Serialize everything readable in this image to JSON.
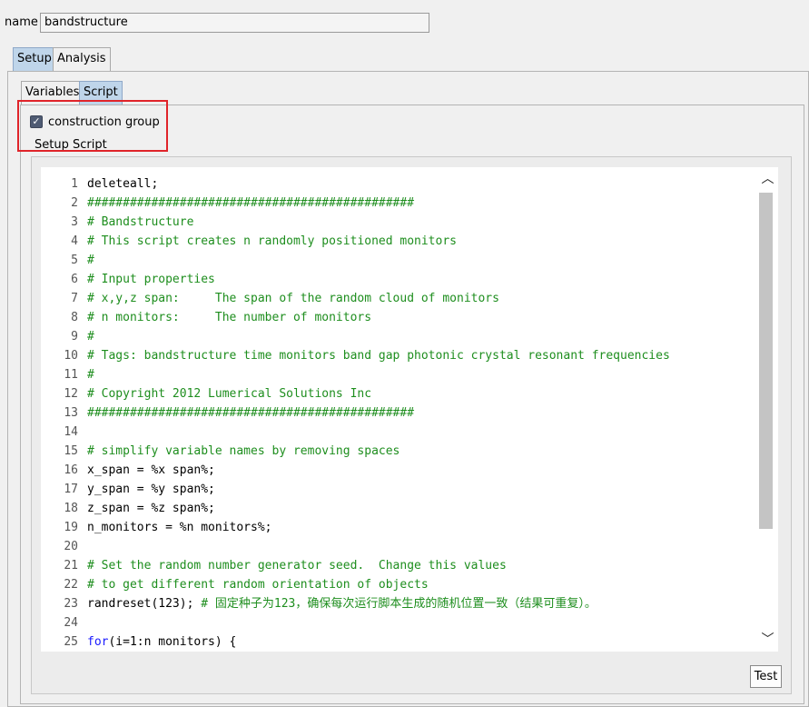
{
  "name_field": {
    "label": "name",
    "value": "bandstructure"
  },
  "tabs": [
    {
      "label": "Setup",
      "active": true
    },
    {
      "label": "Analysis",
      "active": false
    }
  ],
  "subtabs": [
    {
      "label": "Variables",
      "active": false
    },
    {
      "label": "Script",
      "active": true
    }
  ],
  "construction_group": {
    "label": "construction group",
    "checked": true
  },
  "setup_script_label": "Setup Script",
  "editor": {
    "lines": [
      {
        "n": "1",
        "segments": [
          {
            "t": "deleteall;",
            "c": "plain"
          }
        ]
      },
      {
        "n": "2",
        "segments": [
          {
            "t": "##############################################",
            "c": "comment"
          }
        ]
      },
      {
        "n": "3",
        "segments": [
          {
            "t": "# Bandstructure",
            "c": "comment"
          }
        ]
      },
      {
        "n": "4",
        "segments": [
          {
            "t": "# This script creates n randomly positioned monitors",
            "c": "comment"
          }
        ]
      },
      {
        "n": "5",
        "segments": [
          {
            "t": "#",
            "c": "comment"
          }
        ]
      },
      {
        "n": "6",
        "segments": [
          {
            "t": "# Input properties",
            "c": "comment"
          }
        ]
      },
      {
        "n": "7",
        "segments": [
          {
            "t": "# x,y,z span:     The span of the random cloud of monitors",
            "c": "comment"
          }
        ]
      },
      {
        "n": "8",
        "segments": [
          {
            "t": "# n monitors:     The number of monitors",
            "c": "comment"
          }
        ]
      },
      {
        "n": "9",
        "segments": [
          {
            "t": "#",
            "c": "comment"
          }
        ]
      },
      {
        "n": "10",
        "segments": [
          {
            "t": "# Tags: bandstructure time monitors band gap photonic crystal resonant frequencies",
            "c": "comment"
          }
        ]
      },
      {
        "n": "11",
        "segments": [
          {
            "t": "#",
            "c": "comment"
          }
        ]
      },
      {
        "n": "12",
        "segments": [
          {
            "t": "# Copyright 2012 Lumerical Solutions Inc",
            "c": "comment"
          }
        ]
      },
      {
        "n": "13",
        "segments": [
          {
            "t": "##############################################",
            "c": "comment"
          }
        ]
      },
      {
        "n": "14",
        "segments": [
          {
            "t": "",
            "c": "plain"
          }
        ]
      },
      {
        "n": "15",
        "segments": [
          {
            "t": "# simplify variable names by removing spaces",
            "c": "comment"
          }
        ]
      },
      {
        "n": "16",
        "segments": [
          {
            "t": "x_span = %x span%;",
            "c": "plain"
          }
        ]
      },
      {
        "n": "17",
        "segments": [
          {
            "t": "y_span = %y span%;",
            "c": "plain"
          }
        ]
      },
      {
        "n": "18",
        "segments": [
          {
            "t": "z_span = %z span%;",
            "c": "plain"
          }
        ]
      },
      {
        "n": "19",
        "segments": [
          {
            "t": "n_monitors = %n monitors%;",
            "c": "plain"
          }
        ]
      },
      {
        "n": "20",
        "segments": [
          {
            "t": "",
            "c": "plain"
          }
        ]
      },
      {
        "n": "21",
        "segments": [
          {
            "t": "# Set the random number generator seed.  Change this values",
            "c": "comment"
          }
        ]
      },
      {
        "n": "22",
        "segments": [
          {
            "t": "# to get different random orientation of objects",
            "c": "comment"
          }
        ]
      },
      {
        "n": "23",
        "segments": [
          {
            "t": "randreset(123); ",
            "c": "plain"
          },
          {
            "t": "# 固定种子为123，确保每次运行脚本生成的随机位置一致（结果可重复）。",
            "c": "comment"
          }
        ]
      },
      {
        "n": "24",
        "segments": [
          {
            "t": "",
            "c": "plain"
          }
        ]
      },
      {
        "n": "25",
        "segments": [
          {
            "t": "for",
            "c": "keyword"
          },
          {
            "t": "(i=1:n monitors) {",
            "c": "plain"
          }
        ]
      }
    ]
  },
  "scrollbar": {
    "up_icon": "chevron-up-icon",
    "down_icon": "chevron-down-icon"
  },
  "test_button": {
    "label": "Test"
  },
  "colors": {
    "comment": "#1e8e1e",
    "keyword": "#1a1aff",
    "tab_active": "#bfd5ea",
    "highlight": "#e0242a"
  }
}
